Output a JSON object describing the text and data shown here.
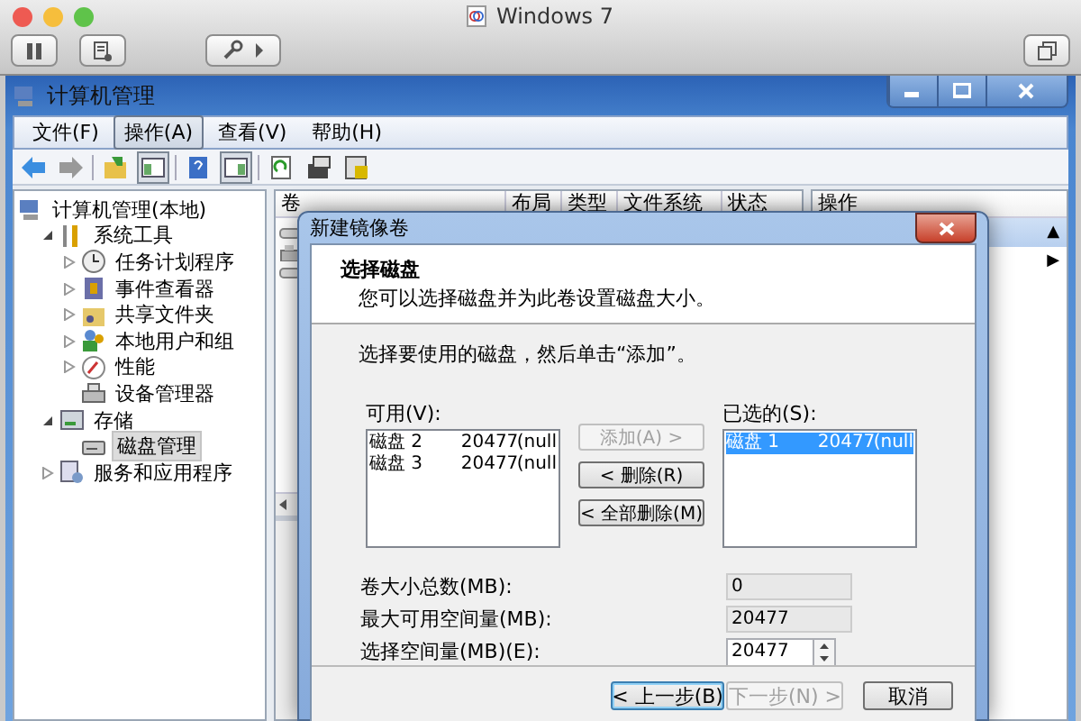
{
  "host": {
    "title": "Windows 7"
  },
  "window": {
    "title": "计算机管理"
  },
  "menu": [
    {
      "label": "文件(F)",
      "selected": false
    },
    {
      "label": "操作(A)",
      "selected": true
    },
    {
      "label": "查看(V)",
      "selected": false
    },
    {
      "label": "帮助(H)",
      "selected": false
    }
  ],
  "toolbar": [
    {
      "pressed": false
    },
    {
      "pressed": false
    },
    {
      "pressed": false
    },
    {
      "pressed": true
    },
    {
      "pressed": false
    },
    {
      "pressed": true
    },
    {
      "pressed": false
    },
    {
      "pressed": false
    },
    {
      "pressed": false
    }
  ],
  "tree": [
    {
      "label": "计算机管理(本地)",
      "selected": false,
      "children": [
        {
          "label": "系统工具",
          "selected": false,
          "expanded": true,
          "children": [
            {
              "label": "任务计划程序",
              "selected": false,
              "expanded": false
            },
            {
              "label": "事件查看器",
              "selected": false,
              "expanded": false
            },
            {
              "label": "共享文件夹",
              "selected": false,
              "expanded": false
            },
            {
              "label": "本地用户和组",
              "selected": false,
              "expanded": false
            },
            {
              "label": "性能",
              "selected": false,
              "expanded": false
            },
            {
              "label": "设备管理器",
              "selected": false
            }
          ]
        },
        {
          "label": "存储",
          "selected": false,
          "expanded": true,
          "children": [
            {
              "label": "磁盘管理",
              "selected": true
            }
          ]
        },
        {
          "label": "服务和应用程序",
          "selected": false,
          "expanded": false
        }
      ]
    }
  ],
  "volumes": {
    "columns": [
      "卷",
      "布局",
      "类型",
      "文件系统",
      "状态"
    ]
  },
  "actions": {
    "title": "操作",
    "rows": [
      {
        "arrow": "▲",
        "selected": true
      },
      {
        "arrow": "▶",
        "selected": false
      }
    ]
  },
  "dialog": {
    "title": "新建镜像卷",
    "heading": "选择磁盘",
    "subtitle": "您可以选择磁盘并为此卷设置磁盘大小。",
    "instruction": "选择要使用的磁盘，然后单击“添加”。",
    "available": {
      "label": "可用(V):",
      "items": [
        {
          "name": "磁盘 2",
          "size": "20477",
          "info": "(null",
          "selected": false
        },
        {
          "name": "磁盘 3",
          "size": "20477",
          "info": "(null",
          "selected": false
        }
      ]
    },
    "move_buttons": [
      {
        "label": "添加(A) >",
        "disabled": true
      },
      {
        "label": "< 删除(R)",
        "disabled": false
      },
      {
        "label": "< 全部删除(M)",
        "disabled": false
      }
    ],
    "chosen": {
      "label": "已选的(S):",
      "items": [
        {
          "name": "磁盘 1",
          "size": "20477",
          "info": "(null",
          "selected": true
        }
      ]
    },
    "fields": [
      {
        "label": "卷大小总数(MB):",
        "value": "0",
        "kind": "readonly"
      },
      {
        "label": "最大可用空间量(MB):",
        "value": "20477",
        "kind": "readonly"
      },
      {
        "label": "选择空间量(MB)(E):",
        "value": "20477",
        "kind": "spin"
      }
    ],
    "footer": [
      {
        "label": "< 上一步(B)",
        "disabled": false,
        "default": true
      },
      {
        "label": "下一步(N) >",
        "disabled": true,
        "default": false
      },
      {
        "label": "取消",
        "disabled": false,
        "default": false
      }
    ]
  }
}
